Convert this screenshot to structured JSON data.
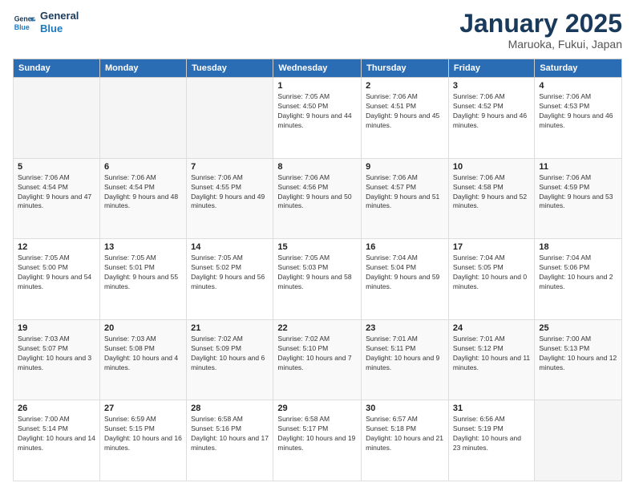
{
  "header": {
    "logo_line1": "General",
    "logo_line2": "Blue",
    "title": "January 2025",
    "subtitle": "Maruoka, Fukui, Japan"
  },
  "weekdays": [
    "Sunday",
    "Monday",
    "Tuesday",
    "Wednesday",
    "Thursday",
    "Friday",
    "Saturday"
  ],
  "weeks": [
    [
      {
        "day": "",
        "sunrise": "",
        "sunset": "",
        "daylight": "",
        "empty": true
      },
      {
        "day": "",
        "sunrise": "",
        "sunset": "",
        "daylight": "",
        "empty": true
      },
      {
        "day": "",
        "sunrise": "",
        "sunset": "",
        "daylight": "",
        "empty": true
      },
      {
        "day": "1",
        "sunrise": "Sunrise: 7:05 AM",
        "sunset": "Sunset: 4:50 PM",
        "daylight": "Daylight: 9 hours and 44 minutes."
      },
      {
        "day": "2",
        "sunrise": "Sunrise: 7:06 AM",
        "sunset": "Sunset: 4:51 PM",
        "daylight": "Daylight: 9 hours and 45 minutes."
      },
      {
        "day": "3",
        "sunrise": "Sunrise: 7:06 AM",
        "sunset": "Sunset: 4:52 PM",
        "daylight": "Daylight: 9 hours and 46 minutes."
      },
      {
        "day": "4",
        "sunrise": "Sunrise: 7:06 AM",
        "sunset": "Sunset: 4:53 PM",
        "daylight": "Daylight: 9 hours and 46 minutes."
      }
    ],
    [
      {
        "day": "5",
        "sunrise": "Sunrise: 7:06 AM",
        "sunset": "Sunset: 4:54 PM",
        "daylight": "Daylight: 9 hours and 47 minutes."
      },
      {
        "day": "6",
        "sunrise": "Sunrise: 7:06 AM",
        "sunset": "Sunset: 4:54 PM",
        "daylight": "Daylight: 9 hours and 48 minutes."
      },
      {
        "day": "7",
        "sunrise": "Sunrise: 7:06 AM",
        "sunset": "Sunset: 4:55 PM",
        "daylight": "Daylight: 9 hours and 49 minutes."
      },
      {
        "day": "8",
        "sunrise": "Sunrise: 7:06 AM",
        "sunset": "Sunset: 4:56 PM",
        "daylight": "Daylight: 9 hours and 50 minutes."
      },
      {
        "day": "9",
        "sunrise": "Sunrise: 7:06 AM",
        "sunset": "Sunset: 4:57 PM",
        "daylight": "Daylight: 9 hours and 51 minutes."
      },
      {
        "day": "10",
        "sunrise": "Sunrise: 7:06 AM",
        "sunset": "Sunset: 4:58 PM",
        "daylight": "Daylight: 9 hours and 52 minutes."
      },
      {
        "day": "11",
        "sunrise": "Sunrise: 7:06 AM",
        "sunset": "Sunset: 4:59 PM",
        "daylight": "Daylight: 9 hours and 53 minutes."
      }
    ],
    [
      {
        "day": "12",
        "sunrise": "Sunrise: 7:05 AM",
        "sunset": "Sunset: 5:00 PM",
        "daylight": "Daylight: 9 hours and 54 minutes."
      },
      {
        "day": "13",
        "sunrise": "Sunrise: 7:05 AM",
        "sunset": "Sunset: 5:01 PM",
        "daylight": "Daylight: 9 hours and 55 minutes."
      },
      {
        "day": "14",
        "sunrise": "Sunrise: 7:05 AM",
        "sunset": "Sunset: 5:02 PM",
        "daylight": "Daylight: 9 hours and 56 minutes."
      },
      {
        "day": "15",
        "sunrise": "Sunrise: 7:05 AM",
        "sunset": "Sunset: 5:03 PM",
        "daylight": "Daylight: 9 hours and 58 minutes."
      },
      {
        "day": "16",
        "sunrise": "Sunrise: 7:04 AM",
        "sunset": "Sunset: 5:04 PM",
        "daylight": "Daylight: 9 hours and 59 minutes."
      },
      {
        "day": "17",
        "sunrise": "Sunrise: 7:04 AM",
        "sunset": "Sunset: 5:05 PM",
        "daylight": "Daylight: 10 hours and 0 minutes."
      },
      {
        "day": "18",
        "sunrise": "Sunrise: 7:04 AM",
        "sunset": "Sunset: 5:06 PM",
        "daylight": "Daylight: 10 hours and 2 minutes."
      }
    ],
    [
      {
        "day": "19",
        "sunrise": "Sunrise: 7:03 AM",
        "sunset": "Sunset: 5:07 PM",
        "daylight": "Daylight: 10 hours and 3 minutes."
      },
      {
        "day": "20",
        "sunrise": "Sunrise: 7:03 AM",
        "sunset": "Sunset: 5:08 PM",
        "daylight": "Daylight: 10 hours and 4 minutes."
      },
      {
        "day": "21",
        "sunrise": "Sunrise: 7:02 AM",
        "sunset": "Sunset: 5:09 PM",
        "daylight": "Daylight: 10 hours and 6 minutes."
      },
      {
        "day": "22",
        "sunrise": "Sunrise: 7:02 AM",
        "sunset": "Sunset: 5:10 PM",
        "daylight": "Daylight: 10 hours and 7 minutes."
      },
      {
        "day": "23",
        "sunrise": "Sunrise: 7:01 AM",
        "sunset": "Sunset: 5:11 PM",
        "daylight": "Daylight: 10 hours and 9 minutes."
      },
      {
        "day": "24",
        "sunrise": "Sunrise: 7:01 AM",
        "sunset": "Sunset: 5:12 PM",
        "daylight": "Daylight: 10 hours and 11 minutes."
      },
      {
        "day": "25",
        "sunrise": "Sunrise: 7:00 AM",
        "sunset": "Sunset: 5:13 PM",
        "daylight": "Daylight: 10 hours and 12 minutes."
      }
    ],
    [
      {
        "day": "26",
        "sunrise": "Sunrise: 7:00 AM",
        "sunset": "Sunset: 5:14 PM",
        "daylight": "Daylight: 10 hours and 14 minutes."
      },
      {
        "day": "27",
        "sunrise": "Sunrise: 6:59 AM",
        "sunset": "Sunset: 5:15 PM",
        "daylight": "Daylight: 10 hours and 16 minutes."
      },
      {
        "day": "28",
        "sunrise": "Sunrise: 6:58 AM",
        "sunset": "Sunset: 5:16 PM",
        "daylight": "Daylight: 10 hours and 17 minutes."
      },
      {
        "day": "29",
        "sunrise": "Sunrise: 6:58 AM",
        "sunset": "Sunset: 5:17 PM",
        "daylight": "Daylight: 10 hours and 19 minutes."
      },
      {
        "day": "30",
        "sunrise": "Sunrise: 6:57 AM",
        "sunset": "Sunset: 5:18 PM",
        "daylight": "Daylight: 10 hours and 21 minutes."
      },
      {
        "day": "31",
        "sunrise": "Sunrise: 6:56 AM",
        "sunset": "Sunset: 5:19 PM",
        "daylight": "Daylight: 10 hours and 23 minutes."
      },
      {
        "day": "",
        "sunrise": "",
        "sunset": "",
        "daylight": "",
        "empty": true
      }
    ]
  ]
}
